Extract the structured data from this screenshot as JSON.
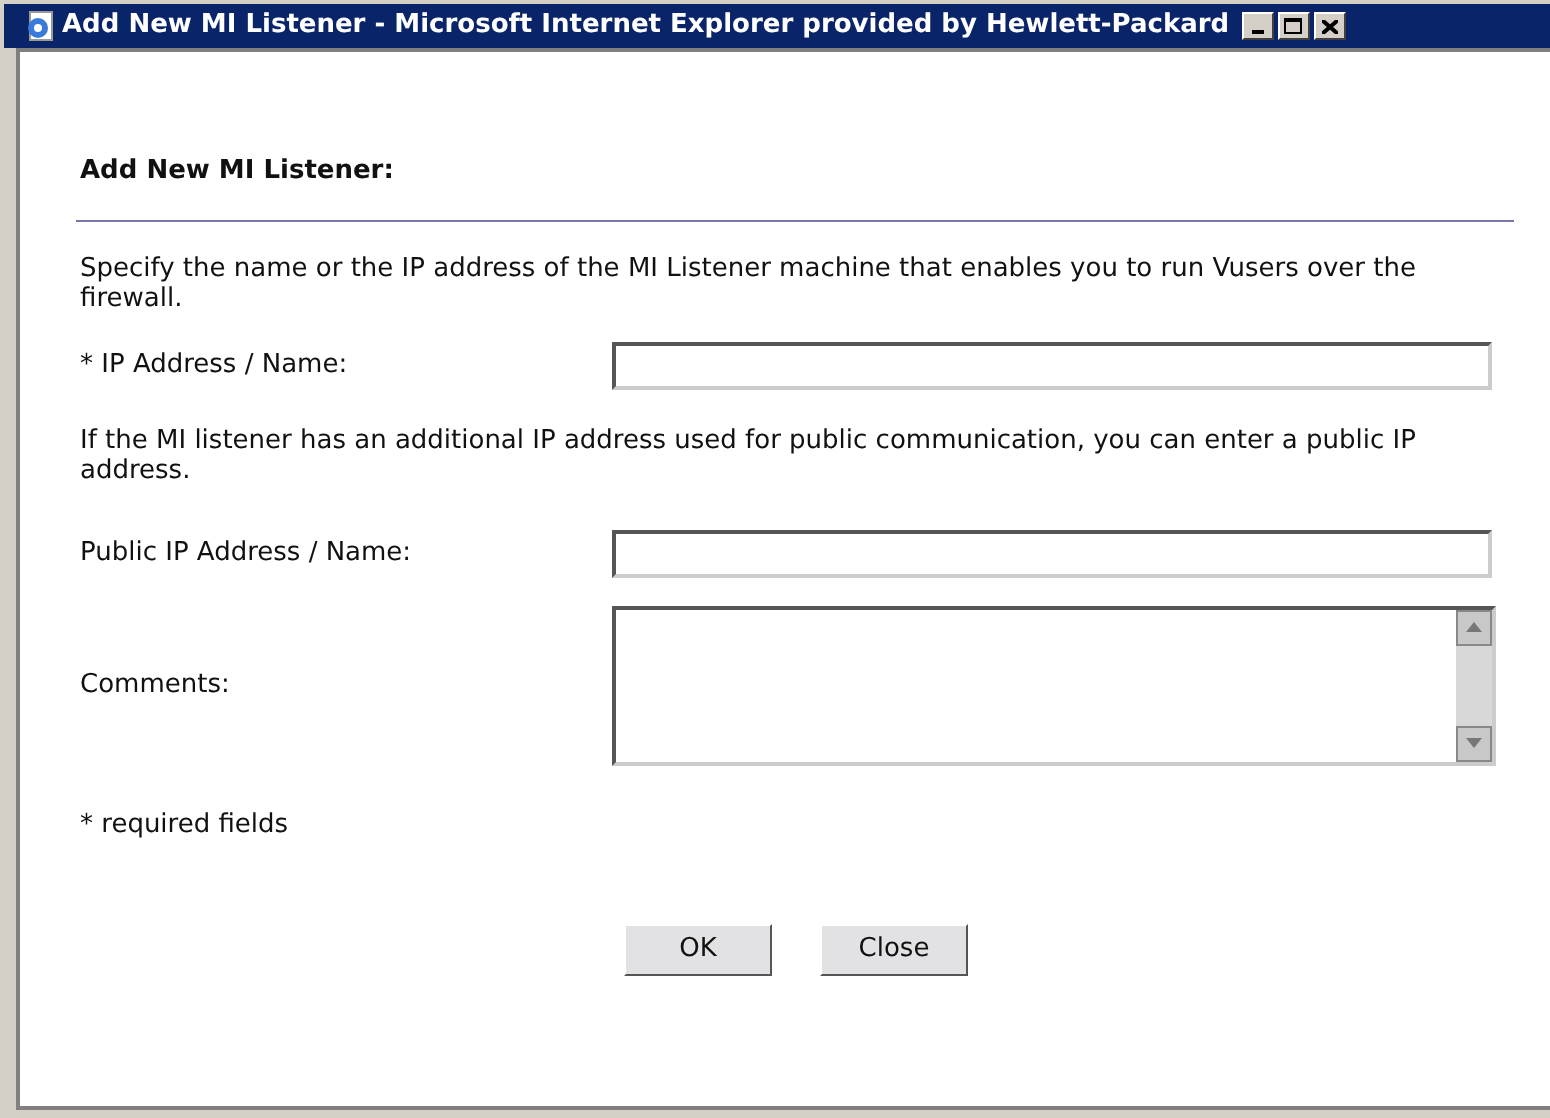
{
  "window": {
    "title": "Add New MI Listener - Microsoft Internet Explorer provided by Hewlett-Packard"
  },
  "heading": "Add New MI Listener:",
  "intro": "Specify the name or the IP address of the MI Listener machine that enables you to run Vusers over the firewall.",
  "fields": [
    {
      "kind": "input",
      "label": "* IP Address / Name:"
    },
    {
      "kind": "note",
      "label": "If the MI listener has an additional IP address used for public communication, you can enter a public IP address."
    },
    {
      "kind": "input",
      "label": "Public IP Address / Name:"
    },
    {
      "kind": "textarea",
      "label": "Comments:"
    }
  ],
  "footnote": "* required fields",
  "buttons": [
    "OK",
    "Close"
  ]
}
